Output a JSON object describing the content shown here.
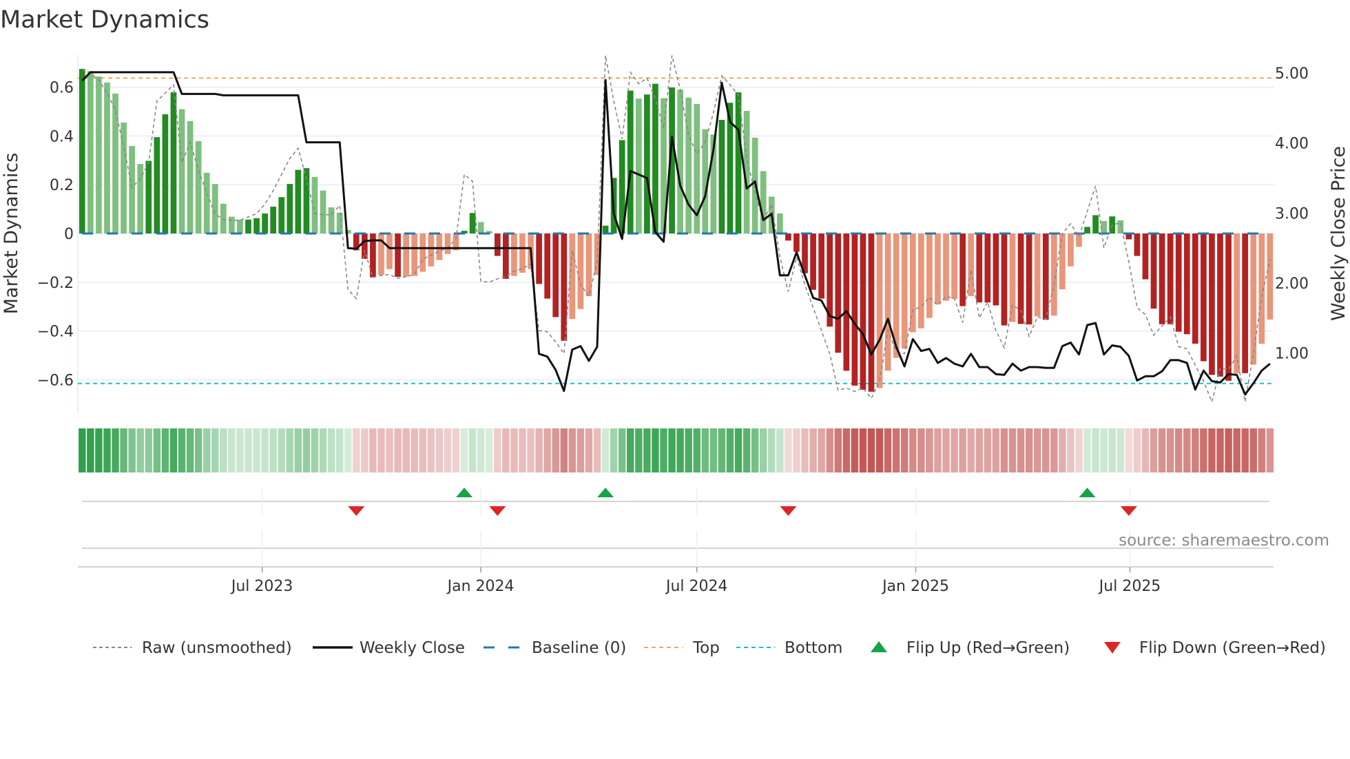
{
  "chart_data": {
    "type": "bar",
    "title": "Market Dynamics",
    "ylabel": "Market Dynamics",
    "ylabel_right": "Weekly Close Price",
    "ylim": [
      -0.72,
      0.74
    ],
    "ylim_right": [
      0.0,
      5.12
    ],
    "left_ticks": [
      {
        "value": 0.6,
        "label": "0.6"
      },
      {
        "value": 0.4,
        "label": "0.4"
      },
      {
        "value": 0.2,
        "label": "0.2"
      },
      {
        "value": 0,
        "label": "0"
      },
      {
        "value": -0.2,
        "label": "−0.2"
      },
      {
        "value": -0.4,
        "label": "−0.4"
      },
      {
        "value": -0.6,
        "label": "−0.6"
      }
    ],
    "right_ticks": [
      {
        "value": 5,
        "label": "5.00"
      },
      {
        "value": 4,
        "label": "4.00"
      },
      {
        "value": 3,
        "label": "3.00"
      },
      {
        "value": 2,
        "label": "2.00"
      },
      {
        "value": 1,
        "label": "1.00"
      }
    ],
    "x_ticks": [
      {
        "week": 21.67,
        "label": "Jul 2023"
      },
      {
        "week": 47.99,
        "label": "Jan 2024"
      },
      {
        "week": 74.0,
        "label": "Jul 2024"
      },
      {
        "week": 100.35,
        "label": "Jan 2025"
      },
      {
        "week": 126.14,
        "label": "Jul 2025"
      }
    ],
    "top_level": 0.6375,
    "bottom_level": -0.615,
    "baseline": 0,
    "grid": true,
    "legend_position": "bottom",
    "colors": {
      "green_strong": "#228b22",
      "green_light": "#7fbf7f",
      "red_strong": "#b22222",
      "red_light": "#e9967a",
      "raw": "#888888",
      "close": "#111111",
      "baseline": "#1f77b4",
      "top": "#f4a460",
      "bottom": "#17becf",
      "flip_up": "#16a34a",
      "flip_down": "#dc2626",
      "heat_green": "#2e9e48",
      "heat_red": "#c0504d"
    },
    "series": [
      {
        "name": "Market Dynamics (smoothed)",
        "values": [
          0.675,
          0.666,
          0.644,
          0.619,
          0.574,
          0.455,
          0.359,
          0.285,
          0.298,
          0.395,
          0.489,
          0.579,
          0.51,
          0.461,
          0.379,
          0.249,
          0.203,
          0.122,
          0.069,
          0.057,
          0.057,
          0.063,
          0.082,
          0.11,
          0.149,
          0.203,
          0.261,
          0.268,
          0.232,
          0.176,
          0.107,
          0.085,
          0.014,
          -0.069,
          -0.104,
          -0.18,
          -0.17,
          -0.146,
          -0.178,
          -0.177,
          -0.174,
          -0.157,
          -0.135,
          -0.109,
          -0.084,
          -0.069,
          0.011,
          0.084,
          0.047,
          0.01,
          -0.092,
          -0.186,
          -0.174,
          -0.161,
          -0.146,
          -0.207,
          -0.267,
          -0.343,
          -0.44,
          -0.351,
          -0.31,
          -0.257,
          -0.17,
          0.032,
          0.228,
          0.383,
          0.586,
          0.553,
          0.57,
          0.614,
          0.555,
          0.599,
          0.59,
          0.557,
          0.531,
          0.428,
          0.406,
          0.466,
          0.536,
          0.579,
          0.503,
          0.393,
          0.256,
          0.151,
          0.082,
          -0.029,
          -0.075,
          -0.163,
          -0.231,
          -0.267,
          -0.382,
          -0.489,
          -0.563,
          -0.624,
          -0.641,
          -0.649,
          -0.634,
          -0.563,
          -0.51,
          -0.472,
          -0.405,
          -0.389,
          -0.346,
          -0.29,
          -0.276,
          -0.268,
          -0.298,
          -0.257,
          -0.283,
          -0.283,
          -0.295,
          -0.377,
          -0.363,
          -0.371,
          -0.373,
          -0.34,
          -0.354,
          -0.337,
          -0.229,
          -0.135,
          -0.055,
          0.027,
          0.075,
          0.051,
          0.07,
          0.054,
          -0.024,
          -0.092,
          -0.188,
          -0.308,
          -0.372,
          -0.372,
          -0.403,
          -0.413,
          -0.452,
          -0.524,
          -0.58,
          -0.587,
          -0.604,
          -0.573,
          -0.573,
          -0.538,
          -0.452,
          -0.353
        ]
      },
      {
        "name": "Raw (unsmoothed)",
        "values": [
          0.675,
          0.656,
          0.63,
          0.576,
          0.506,
          0.355,
          0.19,
          0.224,
          0.29,
          0.543,
          0.576,
          0.61,
          0.29,
          0.374,
          0.26,
          0.167,
          0.08,
          0.058,
          0.054,
          0.054,
          0.068,
          0.082,
          0.12,
          0.176,
          0.242,
          0.308,
          0.35,
          0.224,
          0.082,
          0.077,
          0.077,
          0.115,
          -0.229,
          -0.267,
          -0.069,
          -0.18,
          -0.172,
          -0.168,
          -0.184,
          -0.177,
          -0.168,
          -0.106,
          -0.088,
          -0.073,
          -0.059,
          -0.022,
          0.242,
          0.214,
          -0.196,
          -0.2,
          -0.186,
          -0.177,
          -0.154,
          -0.144,
          -0.125,
          -0.398,
          -0.403,
          -0.445,
          -0.493,
          -0.069,
          -0.21,
          -0.257,
          -0.116,
          0.73,
          0.543,
          0.388,
          0.661,
          0.614,
          0.637,
          0.553,
          0.43,
          0.73,
          0.59,
          0.402,
          0.327,
          0.374,
          0.496,
          0.647,
          0.61,
          0.567,
          0.308,
          0.167,
          0.054,
          0.12,
          -0.097,
          -0.238,
          -0.097,
          -0.21,
          -0.304,
          -0.398,
          -0.493,
          -0.643,
          -0.634,
          -0.648,
          -0.634,
          -0.676,
          -0.606,
          -0.398,
          -0.483,
          -0.493,
          -0.314,
          -0.3,
          -0.262,
          -0.295,
          -0.257,
          -0.267,
          -0.365,
          -0.149,
          -0.347,
          -0.281,
          -0.398,
          -0.469,
          -0.295,
          -0.314,
          -0.422,
          -0.342,
          -0.351,
          -0.21,
          0.0,
          0.04,
          -0.012,
          0.091,
          0.195,
          -0.059,
          0.035,
          0.044,
          -0.116,
          -0.304,
          -0.333,
          -0.417,
          -0.379,
          -0.342,
          -0.464,
          -0.473,
          -0.54,
          -0.606,
          -0.69,
          -0.554,
          -0.558,
          -0.502,
          -0.69,
          -0.493,
          -0.257,
          -0.106
        ]
      },
      {
        "name": "Weekly Close",
        "axis": "right",
        "values": [
          4.89,
          5.01,
          5.01,
          5.01,
          5.01,
          5.01,
          5.01,
          5.01,
          5.01,
          5.01,
          5.01,
          5.01,
          4.7,
          4.7,
          4.7,
          4.7,
          4.7,
          4.68,
          4.68,
          4.68,
          4.68,
          4.68,
          4.68,
          4.68,
          4.68,
          4.68,
          4.68,
          4.01,
          4.01,
          4.01,
          4.01,
          4.01,
          2.5,
          2.49,
          2.6,
          2.61,
          2.61,
          2.5,
          2.5,
          2.5,
          2.5,
          2.5,
          2.5,
          2.5,
          2.5,
          2.5,
          2.5,
          2.5,
          2.5,
          2.5,
          2.5,
          2.5,
          2.5,
          2.5,
          2.5,
          0.99,
          0.95,
          0.76,
          0.46,
          1.05,
          1.1,
          0.89,
          1.09,
          4.9,
          2.99,
          2.63,
          3.6,
          3.55,
          3.5,
          2.73,
          2.59,
          4.09,
          3.39,
          3.12,
          2.97,
          3.24,
          3.91,
          4.86,
          4.3,
          4.19,
          3.35,
          3.45,
          2.9,
          2.99,
          2.11,
          2.11,
          2.44,
          2.11,
          1.79,
          1.75,
          1.53,
          1.49,
          1.6,
          1.42,
          1.27,
          0.98,
          1.19,
          1.49,
          1.09,
          0.81,
          1.2,
          1.03,
          1.06,
          0.86,
          0.93,
          0.85,
          0.81,
          0.99,
          0.8,
          0.8,
          0.7,
          0.69,
          0.85,
          0.75,
          0.8,
          0.8,
          0.79,
          0.79,
          1.1,
          1.15,
          0.98,
          1.4,
          1.43,
          0.98,
          1.11,
          1.09,
          0.96,
          0.61,
          0.67,
          0.67,
          0.74,
          0.9,
          0.9,
          0.86,
          0.48,
          0.75,
          0.6,
          0.58,
          0.7,
          0.69,
          0.41,
          0.57,
          0.75,
          0.85
        ]
      }
    ],
    "flips": [
      {
        "week": 33,
        "direction": "down"
      },
      {
        "week": 46,
        "direction": "up"
      },
      {
        "week": 50,
        "direction": "down"
      },
      {
        "week": 63,
        "direction": "up"
      },
      {
        "week": 85,
        "direction": "down"
      },
      {
        "week": 121,
        "direction": "up"
      },
      {
        "week": 126,
        "direction": "down"
      }
    ],
    "legend": [
      {
        "key": "raw",
        "label": "Raw (unsmoothed)"
      },
      {
        "key": "close",
        "label": "Weekly Close"
      },
      {
        "key": "baseline",
        "label": "Baseline (0)"
      },
      {
        "key": "top",
        "label": "Top"
      },
      {
        "key": "bottom",
        "label": "Bottom"
      },
      {
        "key": "flip_up",
        "label": "Flip Up (Red→Green)"
      },
      {
        "key": "flip_down",
        "label": "Flip Down (Green→Red)"
      }
    ],
    "source": "source: sharemaestro.com"
  }
}
